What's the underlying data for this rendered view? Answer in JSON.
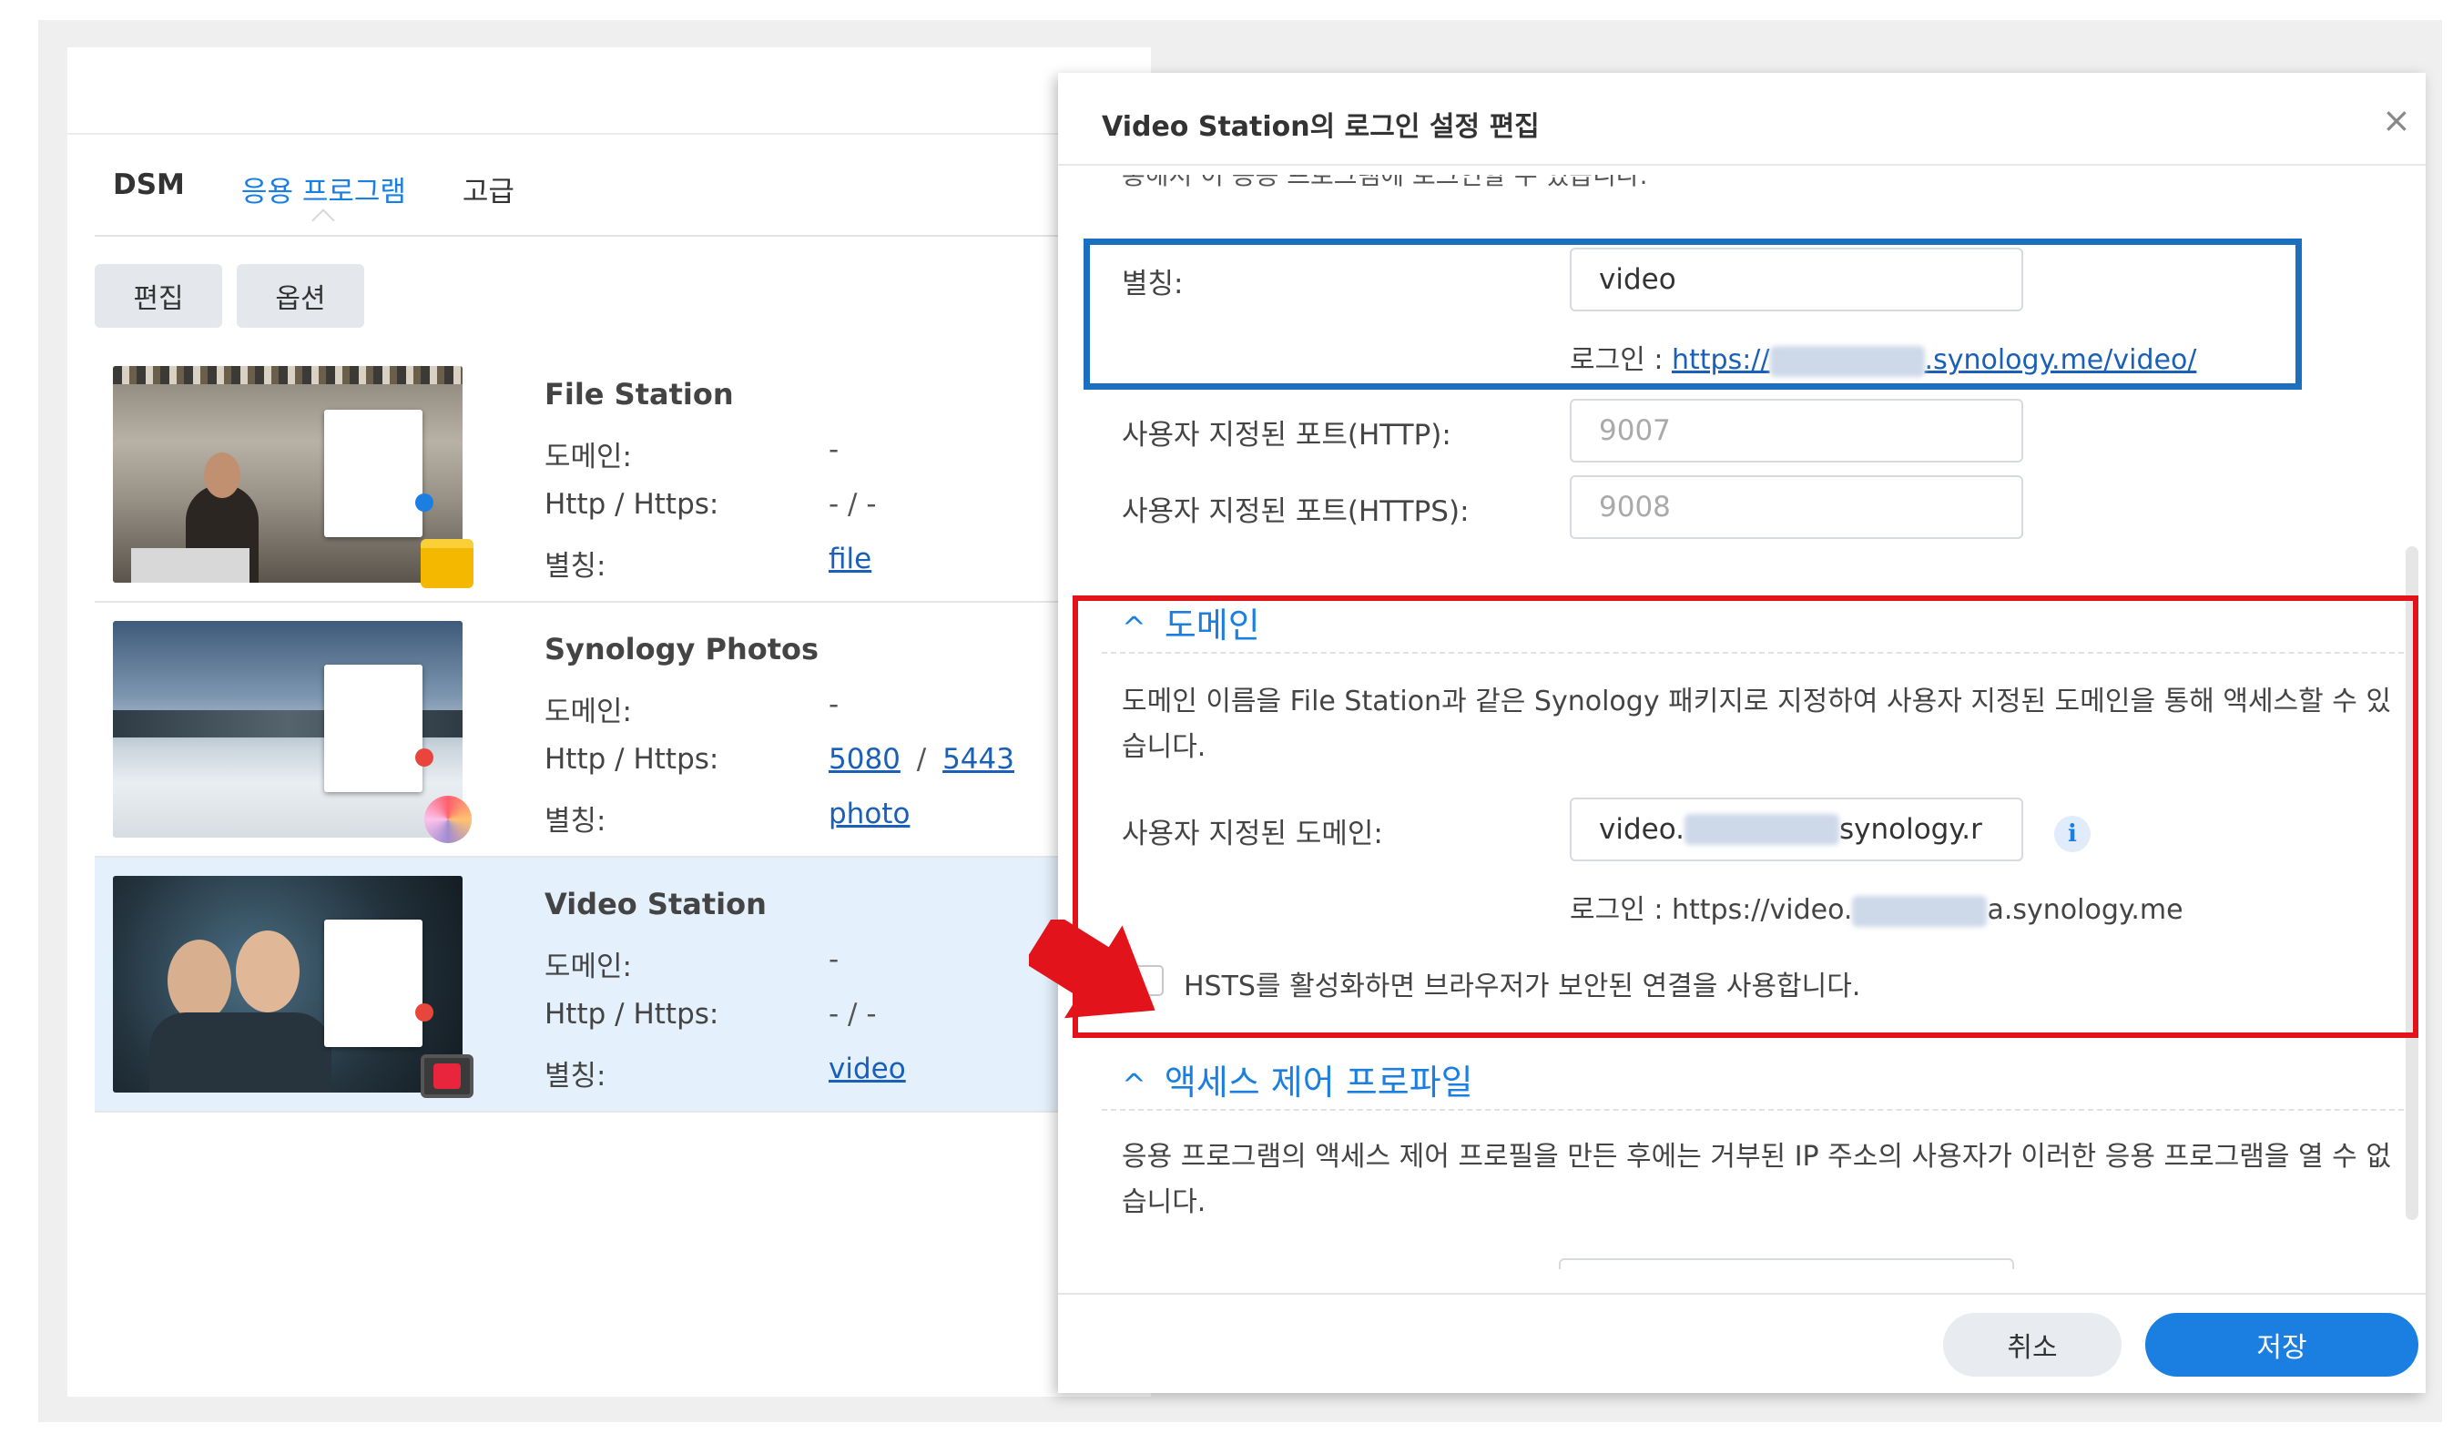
{
  "tabs": {
    "dsm": "DSM",
    "apps": "응용 프로그램",
    "advanced": "고급"
  },
  "toolbar": {
    "edit": "편집",
    "options": "옵션"
  },
  "labels": {
    "domain": "도메인:",
    "http": "Http / Https:",
    "alias": "별칭:"
  },
  "apps": [
    {
      "name": "File Station",
      "domain": "-",
      "http": "- / -",
      "alias": "file"
    },
    {
      "name": "Synology Photos",
      "domain": "-",
      "http_port": "5080",
      "sep": "/",
      "https_port": "5443",
      "alias": "photo"
    },
    {
      "name": "Video Station",
      "domain": "-",
      "http": "- / -",
      "alias": "video"
    }
  ],
  "dialog": {
    "title": "Video Station의 로그인 설정 편집",
    "close": "×",
    "cut_text": "통해서 이 응용 프로그램에 로그인할 수 있습니다.",
    "alias_label": "별칭:",
    "alias_value": "video",
    "alias_login_prefix": "로그인 : ",
    "alias_login_start": "https://",
    "alias_login_end": ".synology.me/video/",
    "http_label": "사용자 지정된 포트(HTTP):",
    "http_placeholder": "9007",
    "https_label": "사용자 지정된 포트(HTTPS):",
    "https_placeholder": "9008",
    "domain_section": "도메인",
    "domain_desc": "도메인 이름을 File Station과 같은 Synology 패키지로 지정하여 사용자 지정된 도메인을 통해 액세스할 수 있습니다.",
    "domain_label": "사용자 지정된 도메인:",
    "domain_value_start": "video.",
    "domain_value_end": "synology.r",
    "domain_login_prefix": "로그인 : ",
    "domain_login_start": "https://video.",
    "domain_login_end": "a.synology.me",
    "hsts_label": "HSTS를 활성화하면 브라우저가 보안된 연결을 사용합니다.",
    "acl_section": "액세스 제어 프로파일",
    "acl_desc": "응용 프로그램의 액세스 제어 프로필을 만든 후에는 거부된 IP 주소의 사용자가 이러한 응용 프로그램을 열 수 없습니다.",
    "cancel": "취소",
    "save": "저장"
  },
  "colors": {
    "accent": "#1a7fe0",
    "blue_box": "#1a6fc0",
    "red_box": "#e3131c"
  }
}
